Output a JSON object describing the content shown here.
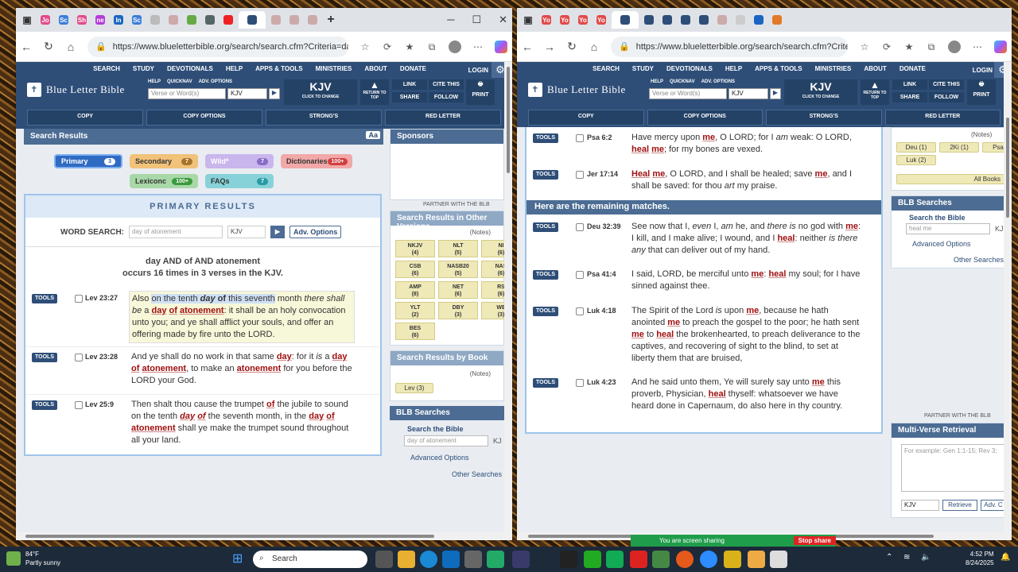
{
  "weather": {
    "temp": "84°F",
    "desc": "Partly sunny"
  },
  "clock": {
    "time": "4:52 PM",
    "date": "8/24/2025"
  },
  "taskbar": {
    "search": "Search"
  },
  "share": {
    "status": "You are screen sharing",
    "stop": "Stop share"
  },
  "left": {
    "url": "https://www.blueletterbible.org/search/search.cfm?Criteria=day+of+atonement...",
    "tabs": [
      {
        "label": "Jo",
        "color": "#e24a8a"
      },
      {
        "label": "Sc",
        "color": "#3b7dd8"
      },
      {
        "label": "Sh",
        "color": "#e24a8a"
      },
      {
        "label": "ne",
        "color": "#b43ad8"
      },
      {
        "label": "In",
        "color": "#1a66c2"
      },
      {
        "label": "Sc",
        "color": "#3b7dd8"
      }
    ],
    "nav": [
      "SEARCH",
      "STUDY",
      "DEVOTIONALS",
      "HELP",
      "APPS & TOOLS",
      "MINISTRIES",
      "ABOUT",
      "DONATE"
    ],
    "login": "LOGIN",
    "logo": "Blue Letter Bible",
    "quicknav": [
      "HELP",
      "QUICKNAV",
      "ADV. OPTIONS"
    ],
    "verse_placeholder": "Verse or Word(s)",
    "version": "KJV",
    "kjv_big": "KJV",
    "kjv_small": "CLICK TO CHANGE",
    "totop": "RETURN TO TOP",
    "link": "LINK",
    "cite": "CITE THIS",
    "share": "SHARE",
    "follow": "FOLLOW",
    "print": "PRINT",
    "tools": [
      "COPY",
      "COPY OPTIONS",
      "STRONG'S",
      "RED LETTER"
    ],
    "results_title": "Search Results",
    "aa": "Aa",
    "pills": [
      {
        "label": "Primary",
        "count": "3"
      },
      {
        "label": "Secondary",
        "count": "7"
      },
      {
        "label": "Wild*",
        "count": "7"
      },
      {
        "label": "Dictionaries",
        "count": "100+"
      },
      {
        "label": "Lexiconc",
        "count": "100+"
      },
      {
        "label": "FAQs",
        "count": "7"
      }
    ],
    "primary_title": "PRIMARY RESULTS",
    "word_search_label": "WORD SEARCH:",
    "word_search_value": "day of atonement",
    "adv": "Adv. Options",
    "occ1": "day AND of AND atonement",
    "occ2": "occurs 16 times in 3 verses in the KJV.",
    "tools_label": "TOOLS",
    "verses": [
      {
        "ref": "Lev 23:27"
      },
      {
        "ref": "Lev 23:28"
      },
      {
        "ref": "Lev 25:9"
      }
    ],
    "sponsors": "Sponsors",
    "partner": "PARTNER WITH THE BLB",
    "other_versions_title": "Search Results in Other Versions",
    "notes": "(Notes)",
    "versions": [
      {
        "n": "NKJV",
        "c": "(4)"
      },
      {
        "n": "NLT",
        "c": "(5)"
      },
      {
        "n": "NI",
        "c": "(6)"
      },
      {
        "n": "CSB",
        "c": "(6)"
      },
      {
        "n": "NASB20",
        "c": "(5)"
      },
      {
        "n": "NAS",
        "c": "(6)"
      },
      {
        "n": "AMP",
        "c": "(8)"
      },
      {
        "n": "NET",
        "c": "(6)"
      },
      {
        "n": "RS",
        "c": "(6)"
      },
      {
        "n": "YLT",
        "c": "(2)"
      },
      {
        "n": "DBY",
        "c": "(3)"
      },
      {
        "n": "WE",
        "c": "(3)"
      },
      {
        "n": "BES",
        "c": "(6)"
      }
    ],
    "by_book_title": "Search Results by Book",
    "books": [
      "Lev (3)"
    ],
    "blb_searches": "BLB Searches",
    "search_bible": "Search the Bible",
    "search_bible_value": "day of atonement",
    "kj": "KJ",
    "adv_options": "Advanced Options",
    "other_searches": "Other Searches"
  },
  "right": {
    "url": "https://www.blueletterbible.org/search/search.cfm?Criteria=heal+me&t=KJV#s=s...",
    "tabs": [
      {
        "label": "Yo",
        "color": "#e24a4a"
      },
      {
        "label": "Yo",
        "color": "#e24a4a"
      },
      {
        "label": "Yo",
        "color": "#e24a4a"
      },
      {
        "label": "Yo",
        "color": "#e24a4a"
      }
    ],
    "nav": [
      "SEARCH",
      "STUDY",
      "DEVOTIONALS",
      "HELP",
      "APPS & TOOLS",
      "MINISTRIES",
      "ABOUT",
      "DONATE"
    ],
    "login": "LOGIN",
    "logo": "Blue Letter Bible",
    "quicknav": [
      "HELP",
      "QUICKNAV",
      "ADV. OPTIONS"
    ],
    "verse_placeholder": "Verse or Word(s)",
    "version": "KJV",
    "kjv_big": "KJV",
    "kjv_small": "CLICK TO CHANGE",
    "totop": "RETURN TO TOP",
    "link": "LINK",
    "cite": "CITE THIS",
    "share": "SHARE",
    "follow": "FOLLOW",
    "print": "PRINT",
    "tools": [
      "COPY",
      "COPY OPTIONS",
      "STRONG'S",
      "RED LETTER"
    ],
    "tools_label": "TOOLS",
    "remaining": "Here are the remaining matches.",
    "verses": [
      {
        "ref": "Psa 6:2"
      },
      {
        "ref": "Jer 17:14"
      },
      {
        "ref": "Deu 32:39"
      },
      {
        "ref": "Psa 41:4"
      },
      {
        "ref": "Luk 4:18"
      },
      {
        "ref": "Luk 4:23"
      }
    ],
    "notes": "(Notes)",
    "book_pills": [
      "Deu (1)",
      "2Ki (1)",
      "Psa",
      "Luk (2)"
    ],
    "all_books": "All Books",
    "blb_searches": "BLB Searches",
    "search_bible": "Search the Bible",
    "search_bible_value": "heal me",
    "kj": "KJ",
    "adv_options": "Advanced Options",
    "other_searches": "Other Searches",
    "partner": "PARTNER WITH THE BLB",
    "mvr_title": "Multi-Verse Retrieval",
    "mvr_placeholder": "For example: Gen 1:1-15; Rev 3;",
    "mvr_version": "KJV",
    "retrieve": "Retrieve",
    "adv_c": "Adv. C"
  }
}
